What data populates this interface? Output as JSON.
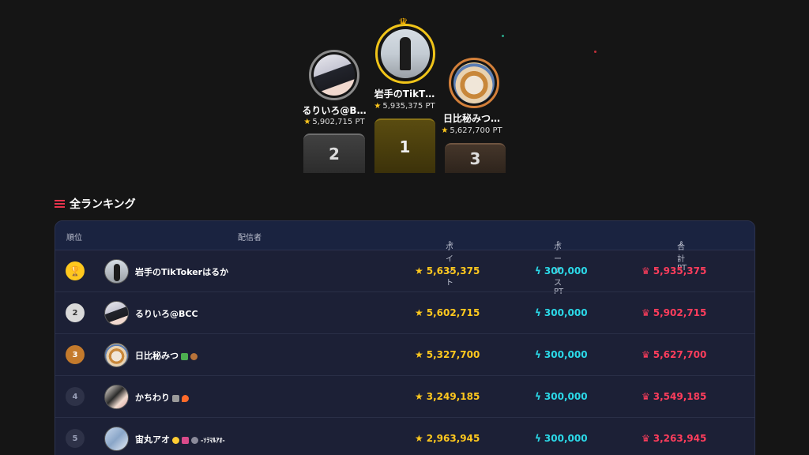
{
  "podium": [
    {
      "rank": "2",
      "name": "るりいろ@B…",
      "points": "5,902,715 PT"
    },
    {
      "rank": "1",
      "name": "岩手のTikT…",
      "points": "5,935,375 PT"
    },
    {
      "rank": "3",
      "name": "日比秘みつ…",
      "points": "5,627,700 PT"
    }
  ],
  "section": {
    "title": "全ランキング"
  },
  "table": {
    "headers": {
      "rank": "順位",
      "streamer": "配信者",
      "points": "ポイント",
      "bonus": "ボーナスPT",
      "total": "合計PT"
    },
    "rows": [
      {
        "rank": "",
        "name": "岩手のTikTokerはるか",
        "points": "5,635,375",
        "bonus": "300,000",
        "total": "5,935,375"
      },
      {
        "rank": "2",
        "name": "るりいろ@BCC",
        "points": "5,602,715",
        "bonus": "300,000",
        "total": "5,902,715"
      },
      {
        "rank": "3",
        "name": "日比秘みつ",
        "points": "5,327,700",
        "bonus": "300,000",
        "total": "5,627,700"
      },
      {
        "rank": "4",
        "name": "かちわり",
        "points": "3,249,185",
        "bonus": "300,000",
        "total": "3,549,185"
      },
      {
        "rank": "5",
        "name": "宙丸アオ",
        "name_suffix": "-ｿﾗﾏﾙｱｵ-",
        "points": "2,963,945",
        "bonus": "300,000",
        "total": "3,263,945"
      }
    ]
  },
  "icons": {
    "first_place_badge": "trophy-icon",
    "points": "star-icon",
    "bonus": "lightning-icon",
    "total": "crown-icon",
    "section": "list-icon",
    "sort": "sort-icon"
  },
  "colors": {
    "background": "#151515",
    "gold": "#ffc81e",
    "bonus": "#2bd9e8",
    "total": "#ff3d5c",
    "list_icon": "#e8344d"
  }
}
